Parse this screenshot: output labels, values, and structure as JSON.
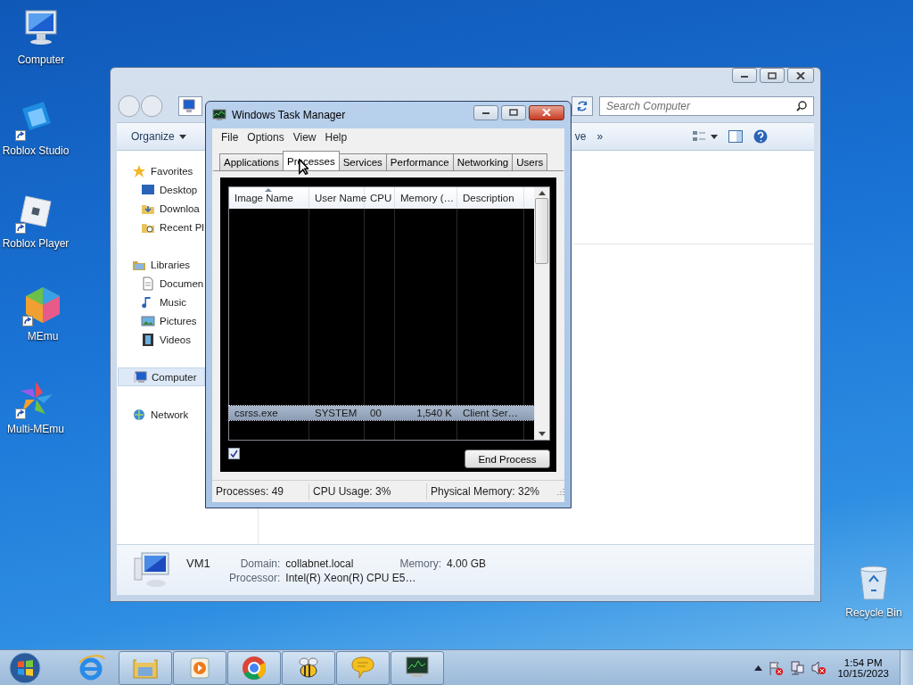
{
  "desktop_icons": [
    {
      "kind": "computer",
      "label": "Computer",
      "shortcut": false
    },
    {
      "kind": "studio",
      "label": "Roblox Studio",
      "shortcut": true
    },
    {
      "kind": "player",
      "label": "Roblox Player",
      "shortcut": true
    },
    {
      "kind": "memu",
      "label": "MEmu",
      "shortcut": true
    },
    {
      "kind": "multi",
      "label": "Multi-MEmu",
      "shortcut": true
    },
    {
      "kind": "recycle",
      "label": "Recycle Bin",
      "shortcut": false
    }
  ],
  "explorer": {
    "search": {
      "placeholder": "Search Computer"
    },
    "toolbar": {
      "organize": "Organize",
      "partial_button": "ve",
      "overflow": "»"
    },
    "sidebar": [
      {
        "kind": "favorites",
        "label": "Favorites",
        "selected": false,
        "children": [
          {
            "kind": "desktop",
            "label": "Desktop",
            "selected": false
          },
          {
            "kind": "downloads",
            "label": "Downloa",
            "selected": false
          },
          {
            "kind": "recent",
            "label": "Recent Pl",
            "selected": false
          }
        ]
      },
      {
        "kind": "libraries",
        "label": "Libraries",
        "selected": false,
        "children": [
          {
            "kind": "documents",
            "label": "Documen",
            "selected": false
          },
          {
            "kind": "music",
            "label": "Music",
            "selected": false
          },
          {
            "kind": "pictures",
            "label": "Pictures",
            "selected": false
          },
          {
            "kind": "videos",
            "label": "Videos",
            "selected": false
          }
        ]
      },
      {
        "kind": "computer",
        "label": "Computer",
        "selected": true
      },
      {
        "kind": "network",
        "label": "Network",
        "selected": false
      }
    ],
    "details": {
      "name": "VM1",
      "fields": [
        {
          "label": "Domain:",
          "value": "collabnet.local"
        },
        {
          "label": "Memory:",
          "value": "4.00 GB"
        },
        {
          "label": "Processor:",
          "value": "Intel(R) Xeon(R) CPU E5…"
        }
      ]
    }
  },
  "task_manager": {
    "title": "Windows Task Manager",
    "menu": [
      "File",
      "Options",
      "View",
      "Help"
    ],
    "tabs": [
      {
        "label": "Applications",
        "selected": false
      },
      {
        "label": "Processes",
        "selected": true
      },
      {
        "label": "Services",
        "selected": false
      },
      {
        "label": "Performance",
        "selected": false
      },
      {
        "label": "Networking",
        "selected": false
      },
      {
        "label": "Users",
        "selected": false
      }
    ],
    "columns": [
      {
        "label": "Image Name",
        "sorted": true
      },
      {
        "label": "User Name",
        "sorted": false
      },
      {
        "label": "CPU",
        "sorted": false
      },
      {
        "label": "Memory (…",
        "sorted": false
      },
      {
        "label": "Description",
        "sorted": false
      }
    ],
    "rows": [
      {
        "cells": [
          "csrss.exe",
          "SYSTEM",
          "00",
          "1,540 K",
          "Client Ser…"
        ],
        "selected": true
      }
    ],
    "show_all_users": {
      "checked": true
    },
    "end_button": "End Process",
    "status_bar": [
      "Processes: 49",
      "CPU Usage: 3%",
      "Physical Memory: 32%"
    ]
  },
  "taskbar": {
    "apps": [
      {
        "kind": "ie",
        "open": false
      },
      {
        "kind": "explorer",
        "open": true
      },
      {
        "kind": "media",
        "open": true
      },
      {
        "kind": "chrome",
        "open": true
      },
      {
        "kind": "bee",
        "open": true
      },
      {
        "kind": "chat",
        "open": true
      },
      {
        "kind": "taskmgr",
        "open": true
      }
    ],
    "time": "1:54 PM",
    "date": "10/15/2023"
  }
}
